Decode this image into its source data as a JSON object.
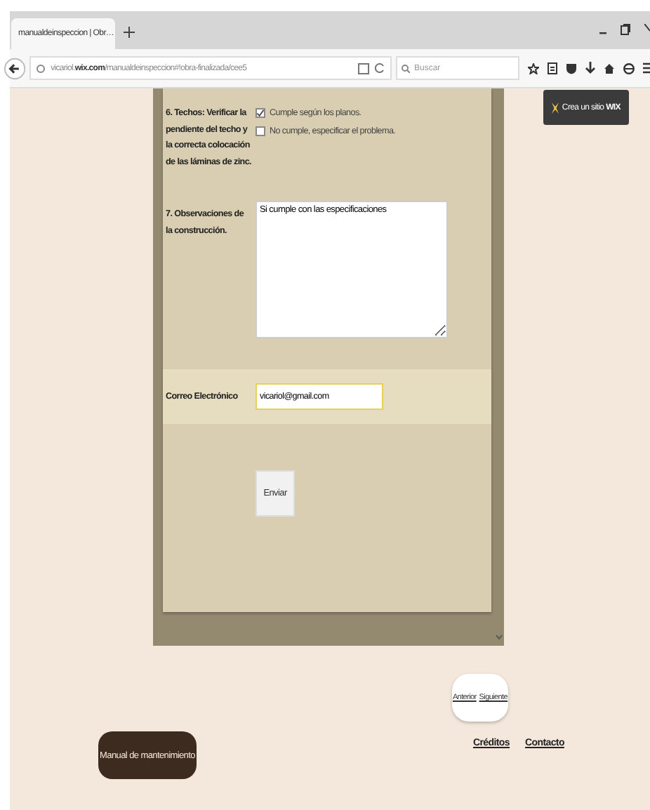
{
  "browser": {
    "tab": {
      "title": "manualdeinspeccion | Obr…",
      "selected": true
    },
    "url": "vicariol.**wix.com**/manualdeinspeccion#!obra-finalizada/cee5",
    "search": {
      "placeholder": "Buscar"
    }
  },
  "wix_badge": {
    "label": "Crea un sitio **WIX**"
  },
  "form": {
    "questions": [
      {
        "kind": "checkboxes",
        "label": "6. Techos: Verificar la pendiente del techo y la correcta colocación de las láminas de zinc.",
        "options": [
          {
            "label": "Cumple según los planos.",
            "checked": true
          },
          {
            "label": "No cumple, especificar el problema.",
            "checked": false
          }
        ]
      },
      {
        "kind": "textarea",
        "label": "7. Observaciones de la construcción.",
        "value": "Si cumple con las especificaciones"
      }
    ],
    "email": {
      "label": "Correo Electrónico",
      "value": "vicariol@gmail.com"
    },
    "submit": "Enviar"
  },
  "pager": [
    "Anterior",
    "Siguiente"
  ],
  "menu_button": "Manual de mantenimiento",
  "footer_links": [
    "Créditos",
    "Contacto"
  ]
}
